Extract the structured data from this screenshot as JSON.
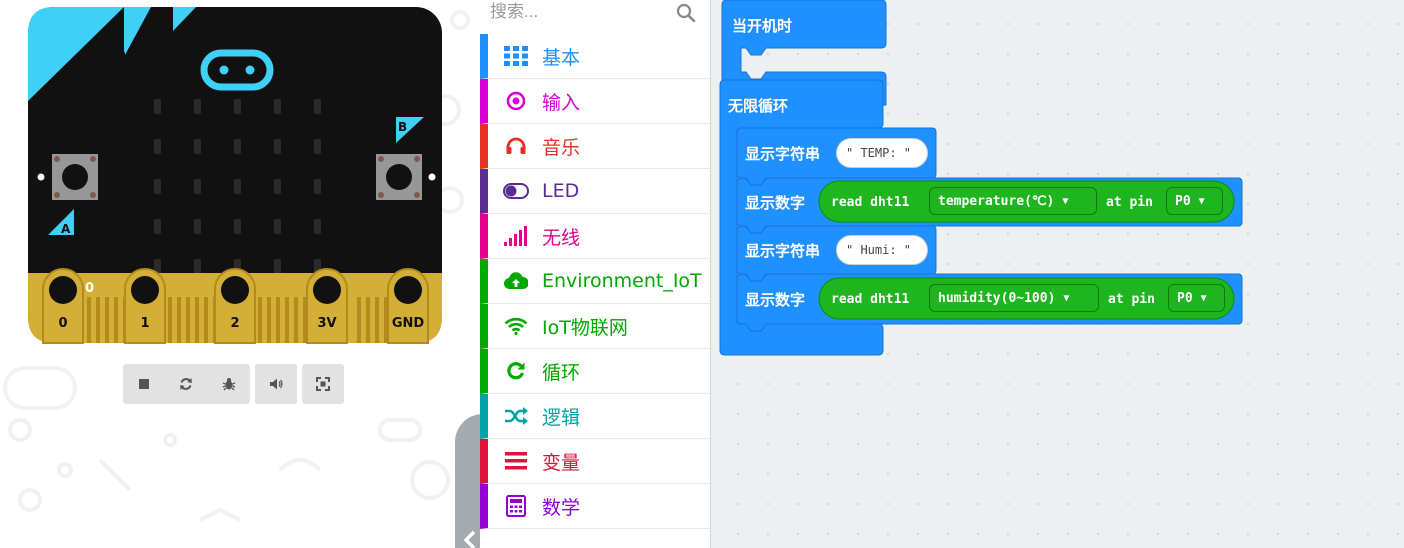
{
  "simulator": {
    "pin_labels": [
      "0",
      "1",
      "2",
      "3V",
      "GND"
    ],
    "pin0_value": "0",
    "button_a_label": "A",
    "button_b_label": "B",
    "toolbar": {
      "stop_icon": "stop-icon",
      "restart_icon": "restart-icon",
      "debug_icon": "bug-icon",
      "mute_icon": "speaker-icon",
      "fullscreen_icon": "fullscreen-icon"
    }
  },
  "toolbox": {
    "search_placeholder": "搜索...",
    "categories": [
      {
        "label": "基本",
        "icon": "grid-icon",
        "color": "#1e90ff"
      },
      {
        "label": "输入",
        "icon": "target-icon",
        "color": "#d400d4"
      },
      {
        "label": "音乐",
        "icon": "headphones-icon",
        "color": "#e63022"
      },
      {
        "label": "LED",
        "icon": "toggle-icon",
        "color": "#5c2d91"
      },
      {
        "label": "无线",
        "icon": "signal-bars-icon",
        "color": "#e3008c"
      },
      {
        "label": "Environment_IoT",
        "icon": "cloud-upload-icon",
        "color": "#00a800"
      },
      {
        "label": "IoT物联网",
        "icon": "wifi-icon",
        "color": "#00a800"
      },
      {
        "label": "循环",
        "icon": "loop-icon",
        "color": "#00aa00"
      },
      {
        "label": "逻辑",
        "icon": "shuffle-icon",
        "color": "#00a4a6"
      },
      {
        "label": "变量",
        "icon": "list-icon",
        "color": "#dc143c"
      },
      {
        "label": "数学",
        "icon": "calculator-icon",
        "color": "#9400d3"
      }
    ]
  },
  "workspace": {
    "on_start_label": "当开机时",
    "forever_label": "无限循环",
    "show_string_label": "显示字符串",
    "show_number_label": "显示数字",
    "string1": "\" TEMP: \"",
    "string2": "\" Humi: \"",
    "read_label": "read dht11",
    "at_pin_label": "at pin",
    "temperature_option": "temperature(℃)",
    "humidity_option": "humidity(0~100)",
    "pin_option": "P0",
    "dropdown_arrow": "▼"
  }
}
